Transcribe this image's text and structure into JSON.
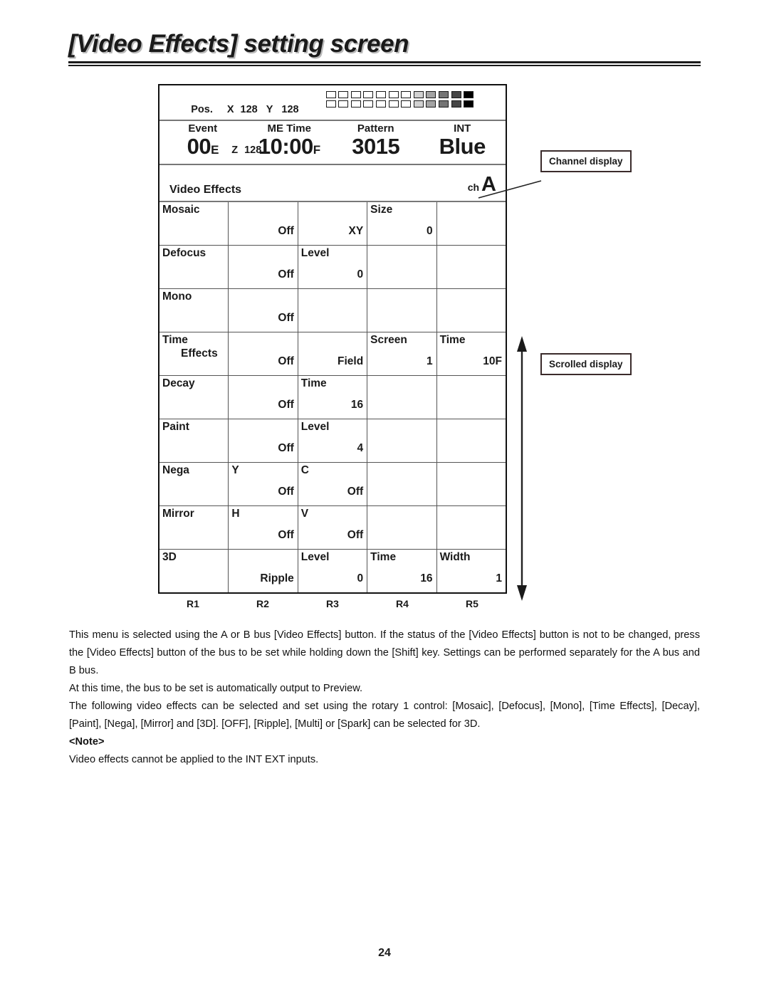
{
  "page": {
    "title": "[Video Effects] setting screen",
    "number": "24"
  },
  "panel": {
    "pos": {
      "label": "Pos.",
      "x_label": "X",
      "x_value": "128",
      "y_label": "Y",
      "y_value": "128",
      "z_label": "Z",
      "z_value": "128",
      "swatch_count": 12,
      "swatch_rows": 2
    },
    "status": [
      {
        "label": "Event",
        "value": "00",
        "suffix": "E"
      },
      {
        "label": "ME Time",
        "value": "10:00",
        "suffix": "F"
      },
      {
        "label": "Pattern",
        "value": "3015",
        "suffix": ""
      },
      {
        "label": "INT",
        "value": "Blue",
        "suffix": ""
      }
    ],
    "menu_title": "Video Effects",
    "channel": {
      "prefix": "ch",
      "value": "A"
    },
    "columns": [
      "R1",
      "R2",
      "R3",
      "R4",
      "R5"
    ],
    "rows": [
      {
        "name": "mosaic",
        "cells": [
          {
            "label": "Mosaic",
            "label2": "",
            "value": ""
          },
          {
            "label": "",
            "label2": "",
            "value": "Off"
          },
          {
            "label": "",
            "label2": "",
            "value": "XY"
          },
          {
            "label": "Size",
            "label2": "",
            "value": "0"
          },
          {
            "label": "",
            "label2": "",
            "value": ""
          }
        ]
      },
      {
        "name": "defocus",
        "cells": [
          {
            "label": "Defocus",
            "label2": "",
            "value": ""
          },
          {
            "label": "",
            "label2": "",
            "value": "Off"
          },
          {
            "label": "Level",
            "label2": "",
            "value": "0"
          },
          {
            "label": "",
            "label2": "",
            "value": ""
          },
          {
            "label": "",
            "label2": "",
            "value": ""
          }
        ]
      },
      {
        "name": "mono",
        "cells": [
          {
            "label": "Mono",
            "label2": "",
            "value": ""
          },
          {
            "label": "",
            "label2": "",
            "value": "Off"
          },
          {
            "label": "",
            "label2": "",
            "value": ""
          },
          {
            "label": "",
            "label2": "",
            "value": ""
          },
          {
            "label": "",
            "label2": "",
            "value": ""
          }
        ]
      },
      {
        "name": "time-effects",
        "cells": [
          {
            "label": "Time",
            "label2": "Effects",
            "value": ""
          },
          {
            "label": "",
            "label2": "",
            "value": "Off"
          },
          {
            "label": "",
            "label2": "",
            "value": "Field"
          },
          {
            "label": "Screen",
            "label2": "",
            "value": "1"
          },
          {
            "label": "Time",
            "label2": "",
            "value": "10F"
          }
        ]
      },
      {
        "name": "decay",
        "cells": [
          {
            "label": "Decay",
            "label2": "",
            "value": ""
          },
          {
            "label": "",
            "label2": "",
            "value": "Off"
          },
          {
            "label": "Time",
            "label2": "",
            "value": "16"
          },
          {
            "label": "",
            "label2": "",
            "value": ""
          },
          {
            "label": "",
            "label2": "",
            "value": ""
          }
        ]
      },
      {
        "name": "paint",
        "cells": [
          {
            "label": "Paint",
            "label2": "",
            "value": ""
          },
          {
            "label": "",
            "label2": "",
            "value": "Off"
          },
          {
            "label": "Level",
            "label2": "",
            "value": "4"
          },
          {
            "label": "",
            "label2": "",
            "value": ""
          },
          {
            "label": "",
            "label2": "",
            "value": ""
          }
        ]
      },
      {
        "name": "nega",
        "cells": [
          {
            "label": "Nega",
            "label2": "",
            "value": ""
          },
          {
            "label": "Y",
            "label2": "",
            "value": "Off"
          },
          {
            "label": "C",
            "label2": "",
            "value": "Off"
          },
          {
            "label": "",
            "label2": "",
            "value": ""
          },
          {
            "label": "",
            "label2": "",
            "value": ""
          }
        ]
      },
      {
        "name": "mirror",
        "cells": [
          {
            "label": "Mirror",
            "label2": "",
            "value": ""
          },
          {
            "label": "H",
            "label2": "",
            "value": "Off"
          },
          {
            "label": "V",
            "label2": "",
            "value": "Off"
          },
          {
            "label": "",
            "label2": "",
            "value": ""
          },
          {
            "label": "",
            "label2": "",
            "value": ""
          }
        ]
      },
      {
        "name": "3d",
        "cells": [
          {
            "label": "3D",
            "label2": "",
            "value": ""
          },
          {
            "label": "",
            "label2": "",
            "value": "Ripple"
          },
          {
            "label": "Level",
            "label2": "",
            "value": "0"
          },
          {
            "label": "Time",
            "label2": "",
            "value": "16"
          },
          {
            "label": "Width",
            "label2": "",
            "value": "1"
          }
        ]
      }
    ]
  },
  "callouts": {
    "channel": "Channel display",
    "scrolled": "Scrolled display"
  },
  "body": {
    "p1": "This menu is selected using the A or B bus [Video Effects] button.  If the status of the [Video Effects] button is not to be changed, press the [Video Effects] button of the bus to be set while holding down the [Shift] key.  Settings can be performed separately for the A bus and B bus.",
    "p2": "At this time, the bus to be set is automatically output to Preview.",
    "p3": "The following video effects can be selected and set using the rotary 1 control: [Mosaic], [Defocus], [Mono], [Time Effects], [Decay], [Paint], [Nega], [Mirror] and [3D].  [OFF], [Ripple], [Multi] or [Spark] can be selected for 3D.",
    "note_head": "<Note>",
    "note_body": "Video effects cannot be applied to the INT EXT inputs."
  }
}
